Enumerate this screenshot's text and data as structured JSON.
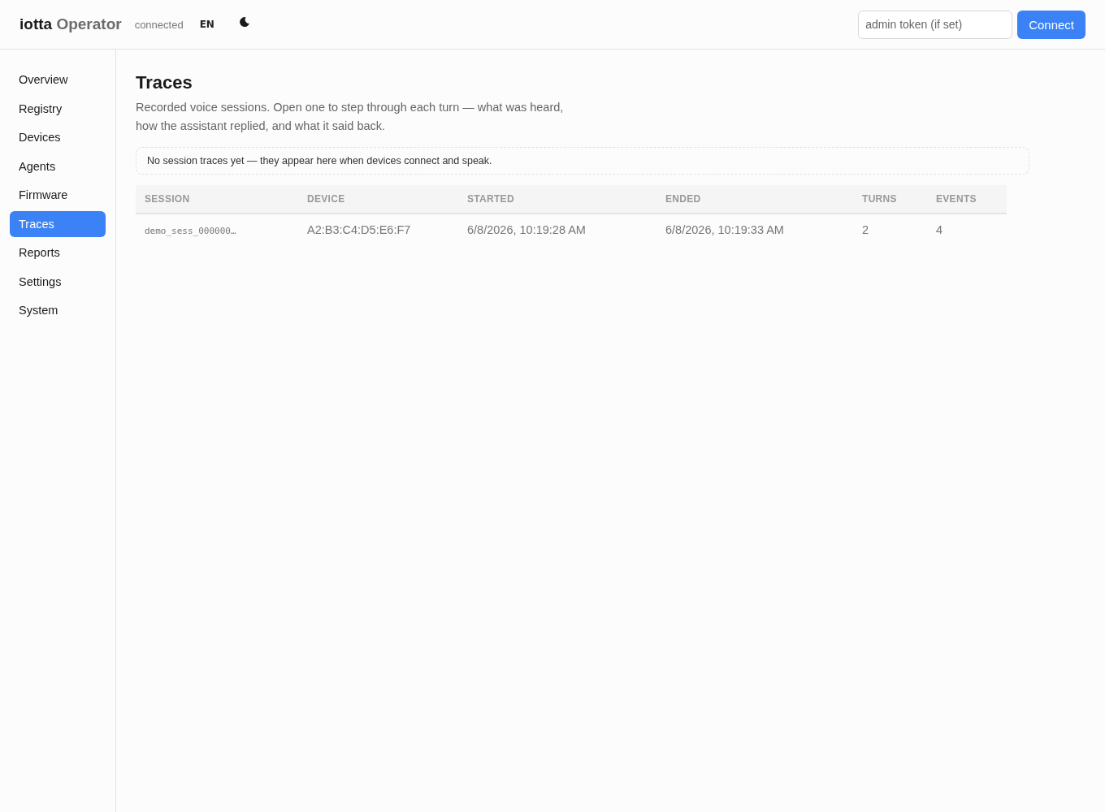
{
  "header": {
    "brand_first": "iotta",
    "brand_second": "Operator",
    "status": "connected",
    "language": "EN",
    "token_field": {
      "placeholder": "admin token (if set)"
    },
    "connect_button": "Connect"
  },
  "sidebar": {
    "items": [
      {
        "label": "Overview",
        "selected": false
      },
      {
        "label": "Registry",
        "selected": false
      },
      {
        "label": "Devices",
        "selected": false
      },
      {
        "label": "Agents",
        "selected": false
      },
      {
        "label": "Firmware",
        "selected": false
      },
      {
        "label": "Traces",
        "selected": true
      },
      {
        "label": "Reports",
        "selected": false
      },
      {
        "label": "Settings",
        "selected": false
      },
      {
        "label": "System",
        "selected": false
      }
    ]
  },
  "page": {
    "title": "Traces",
    "description": "Recorded voice sessions. Open one to step through each turn — what was heard, how the assistant replied, and what it said back.",
    "notice": "No session traces yet — they appear here when devices connect and speak."
  },
  "table": {
    "columns": [
      "SESSION",
      "DEVICE",
      "STARTED",
      "ENDED",
      "TURNS",
      "EVENTS"
    ],
    "rows": [
      [
        "demo_sess_000000…",
        "A2:B3:C4:D5:E6:F7",
        "6/8/2026, 10:19:28 AM",
        "6/8/2026, 10:19:33 AM",
        "2",
        "4"
      ]
    ]
  }
}
